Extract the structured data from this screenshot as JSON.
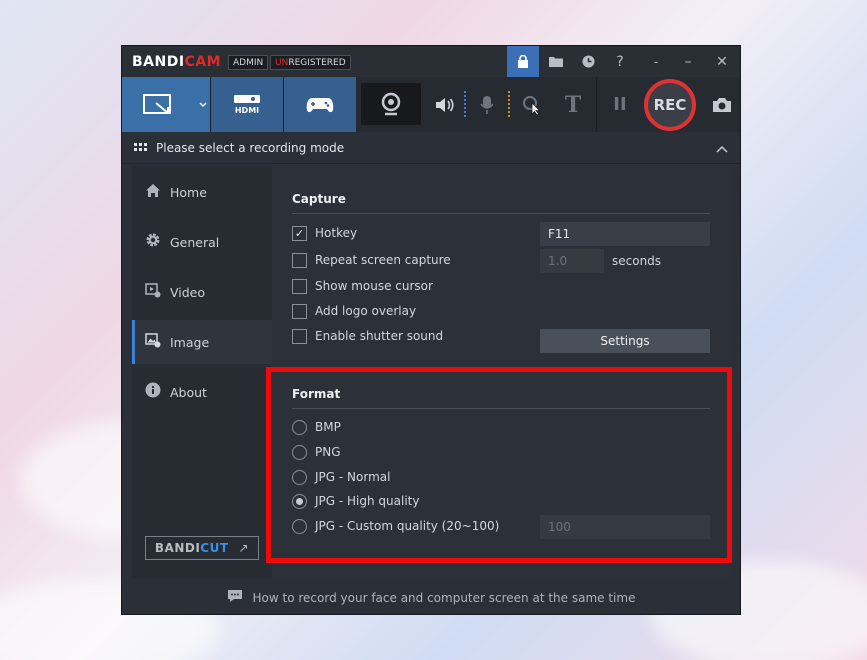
{
  "titlebar": {
    "brand_main": "BANDI",
    "brand_accent": "CAM",
    "tag_admin": "ADMIN",
    "tag_unreg_prefix": "UN",
    "tag_unreg_rest": "REGISTERED",
    "help": "?",
    "minimize_small": "-",
    "minimize": "–",
    "close": "✕"
  },
  "toolbar": {
    "hdmi_label": "HDMI",
    "rec_label": "REC",
    "text_tool": "T",
    "pause": "II"
  },
  "modebar": {
    "label": "Please select a recording mode"
  },
  "sidebar": {
    "items": [
      {
        "label": "Home"
      },
      {
        "label": "General"
      },
      {
        "label": "Video"
      },
      {
        "label": "Image"
      },
      {
        "label": "About"
      }
    ],
    "bandicut_main": "BANDI",
    "bandicut_accent": "CUT",
    "bandicut_arrow": "↗"
  },
  "capture": {
    "title": "Capture",
    "hotkey": {
      "label": "Hotkey",
      "checked": true,
      "value": "F11"
    },
    "repeat": {
      "label": "Repeat screen capture",
      "checked": false,
      "value": "1.0",
      "unit": "seconds"
    },
    "cursor": {
      "label": "Show mouse cursor",
      "checked": false
    },
    "logo": {
      "label": "Add logo overlay",
      "checked": false
    },
    "shutter": {
      "label": "Enable shutter sound",
      "checked": false
    },
    "settings_button": "Settings"
  },
  "format": {
    "title": "Format",
    "options": [
      {
        "label": "BMP",
        "selected": false
      },
      {
        "label": "PNG",
        "selected": false
      },
      {
        "label": "JPG - Normal",
        "selected": false
      },
      {
        "label": "JPG - High quality",
        "selected": true
      },
      {
        "label": "JPG - Custom quality (20~100)",
        "selected": false
      }
    ],
    "custom_quality_value": "100"
  },
  "footer": {
    "text": "How to record your face and computer screen at the same time"
  },
  "colors": {
    "accent_blue": "#3b6fa8",
    "rec_red": "#dd3333",
    "highlight_red": "#ee0a0a"
  }
}
